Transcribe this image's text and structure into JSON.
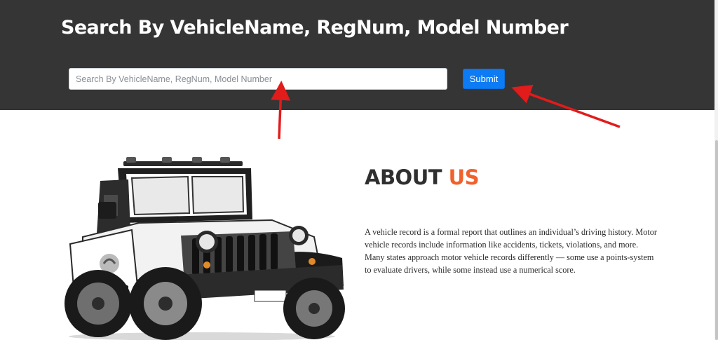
{
  "header": {
    "title": "Search By VehicleName, RegNum, Model Number"
  },
  "search": {
    "placeholder": "Search By VehicleName, RegNum, Model Number",
    "value": "",
    "submit_label": "Submit"
  },
  "about": {
    "heading_dark": "ABOUT",
    "heading_accent": "US",
    "body": "A vehicle record is a formal report that outlines an individual’s driving history. Motor vehicle records include information like accidents, tickets, violations, and more. Many states approach motor vehicle records differently — some use a points-system to evaluate drivers, while some instead use a numerical score."
  },
  "colors": {
    "hero_background": "#353535",
    "accent_orange": "#f0612c",
    "button_blue": "#0d7bf3",
    "annotation_red": "#e21b1b"
  },
  "icons": {
    "vehicle_image": "jeep-image",
    "annotation_arrows": "red-arrow-icon"
  }
}
